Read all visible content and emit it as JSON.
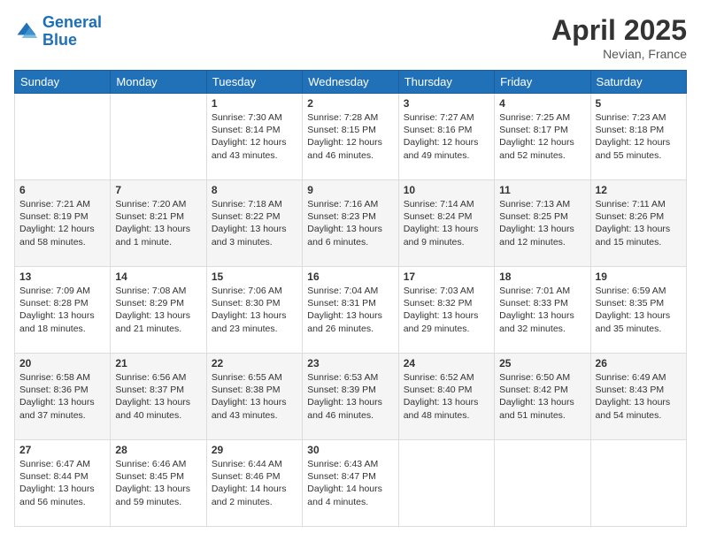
{
  "header": {
    "logo_general": "General",
    "logo_blue": "Blue",
    "month_year": "April 2025",
    "location": "Nevian, France"
  },
  "days_of_week": [
    "Sunday",
    "Monday",
    "Tuesday",
    "Wednesday",
    "Thursday",
    "Friday",
    "Saturday"
  ],
  "weeks": [
    [
      {
        "day": "",
        "sunrise": "",
        "sunset": "",
        "daylight": ""
      },
      {
        "day": "",
        "sunrise": "",
        "sunset": "",
        "daylight": ""
      },
      {
        "day": "1",
        "sunrise": "Sunrise: 7:30 AM",
        "sunset": "Sunset: 8:14 PM",
        "daylight": "Daylight: 12 hours and 43 minutes."
      },
      {
        "day": "2",
        "sunrise": "Sunrise: 7:28 AM",
        "sunset": "Sunset: 8:15 PM",
        "daylight": "Daylight: 12 hours and 46 minutes."
      },
      {
        "day": "3",
        "sunrise": "Sunrise: 7:27 AM",
        "sunset": "Sunset: 8:16 PM",
        "daylight": "Daylight: 12 hours and 49 minutes."
      },
      {
        "day": "4",
        "sunrise": "Sunrise: 7:25 AM",
        "sunset": "Sunset: 8:17 PM",
        "daylight": "Daylight: 12 hours and 52 minutes."
      },
      {
        "day": "5",
        "sunrise": "Sunrise: 7:23 AM",
        "sunset": "Sunset: 8:18 PM",
        "daylight": "Daylight: 12 hours and 55 minutes."
      }
    ],
    [
      {
        "day": "6",
        "sunrise": "Sunrise: 7:21 AM",
        "sunset": "Sunset: 8:19 PM",
        "daylight": "Daylight: 12 hours and 58 minutes."
      },
      {
        "day": "7",
        "sunrise": "Sunrise: 7:20 AM",
        "sunset": "Sunset: 8:21 PM",
        "daylight": "Daylight: 13 hours and 1 minute."
      },
      {
        "day": "8",
        "sunrise": "Sunrise: 7:18 AM",
        "sunset": "Sunset: 8:22 PM",
        "daylight": "Daylight: 13 hours and 3 minutes."
      },
      {
        "day": "9",
        "sunrise": "Sunrise: 7:16 AM",
        "sunset": "Sunset: 8:23 PM",
        "daylight": "Daylight: 13 hours and 6 minutes."
      },
      {
        "day": "10",
        "sunrise": "Sunrise: 7:14 AM",
        "sunset": "Sunset: 8:24 PM",
        "daylight": "Daylight: 13 hours and 9 minutes."
      },
      {
        "day": "11",
        "sunrise": "Sunrise: 7:13 AM",
        "sunset": "Sunset: 8:25 PM",
        "daylight": "Daylight: 13 hours and 12 minutes."
      },
      {
        "day": "12",
        "sunrise": "Sunrise: 7:11 AM",
        "sunset": "Sunset: 8:26 PM",
        "daylight": "Daylight: 13 hours and 15 minutes."
      }
    ],
    [
      {
        "day": "13",
        "sunrise": "Sunrise: 7:09 AM",
        "sunset": "Sunset: 8:28 PM",
        "daylight": "Daylight: 13 hours and 18 minutes."
      },
      {
        "day": "14",
        "sunrise": "Sunrise: 7:08 AM",
        "sunset": "Sunset: 8:29 PM",
        "daylight": "Daylight: 13 hours and 21 minutes."
      },
      {
        "day": "15",
        "sunrise": "Sunrise: 7:06 AM",
        "sunset": "Sunset: 8:30 PM",
        "daylight": "Daylight: 13 hours and 23 minutes."
      },
      {
        "day": "16",
        "sunrise": "Sunrise: 7:04 AM",
        "sunset": "Sunset: 8:31 PM",
        "daylight": "Daylight: 13 hours and 26 minutes."
      },
      {
        "day": "17",
        "sunrise": "Sunrise: 7:03 AM",
        "sunset": "Sunset: 8:32 PM",
        "daylight": "Daylight: 13 hours and 29 minutes."
      },
      {
        "day": "18",
        "sunrise": "Sunrise: 7:01 AM",
        "sunset": "Sunset: 8:33 PM",
        "daylight": "Daylight: 13 hours and 32 minutes."
      },
      {
        "day": "19",
        "sunrise": "Sunrise: 6:59 AM",
        "sunset": "Sunset: 8:35 PM",
        "daylight": "Daylight: 13 hours and 35 minutes."
      }
    ],
    [
      {
        "day": "20",
        "sunrise": "Sunrise: 6:58 AM",
        "sunset": "Sunset: 8:36 PM",
        "daylight": "Daylight: 13 hours and 37 minutes."
      },
      {
        "day": "21",
        "sunrise": "Sunrise: 6:56 AM",
        "sunset": "Sunset: 8:37 PM",
        "daylight": "Daylight: 13 hours and 40 minutes."
      },
      {
        "day": "22",
        "sunrise": "Sunrise: 6:55 AM",
        "sunset": "Sunset: 8:38 PM",
        "daylight": "Daylight: 13 hours and 43 minutes."
      },
      {
        "day": "23",
        "sunrise": "Sunrise: 6:53 AM",
        "sunset": "Sunset: 8:39 PM",
        "daylight": "Daylight: 13 hours and 46 minutes."
      },
      {
        "day": "24",
        "sunrise": "Sunrise: 6:52 AM",
        "sunset": "Sunset: 8:40 PM",
        "daylight": "Daylight: 13 hours and 48 minutes."
      },
      {
        "day": "25",
        "sunrise": "Sunrise: 6:50 AM",
        "sunset": "Sunset: 8:42 PM",
        "daylight": "Daylight: 13 hours and 51 minutes."
      },
      {
        "day": "26",
        "sunrise": "Sunrise: 6:49 AM",
        "sunset": "Sunset: 8:43 PM",
        "daylight": "Daylight: 13 hours and 54 minutes."
      }
    ],
    [
      {
        "day": "27",
        "sunrise": "Sunrise: 6:47 AM",
        "sunset": "Sunset: 8:44 PM",
        "daylight": "Daylight: 13 hours and 56 minutes."
      },
      {
        "day": "28",
        "sunrise": "Sunrise: 6:46 AM",
        "sunset": "Sunset: 8:45 PM",
        "daylight": "Daylight: 13 hours and 59 minutes."
      },
      {
        "day": "29",
        "sunrise": "Sunrise: 6:44 AM",
        "sunset": "Sunset: 8:46 PM",
        "daylight": "Daylight: 14 hours and 2 minutes."
      },
      {
        "day": "30",
        "sunrise": "Sunrise: 6:43 AM",
        "sunset": "Sunset: 8:47 PM",
        "daylight": "Daylight: 14 hours and 4 minutes."
      },
      {
        "day": "",
        "sunrise": "",
        "sunset": "",
        "daylight": ""
      },
      {
        "day": "",
        "sunrise": "",
        "sunset": "",
        "daylight": ""
      },
      {
        "day": "",
        "sunrise": "",
        "sunset": "",
        "daylight": ""
      }
    ]
  ]
}
